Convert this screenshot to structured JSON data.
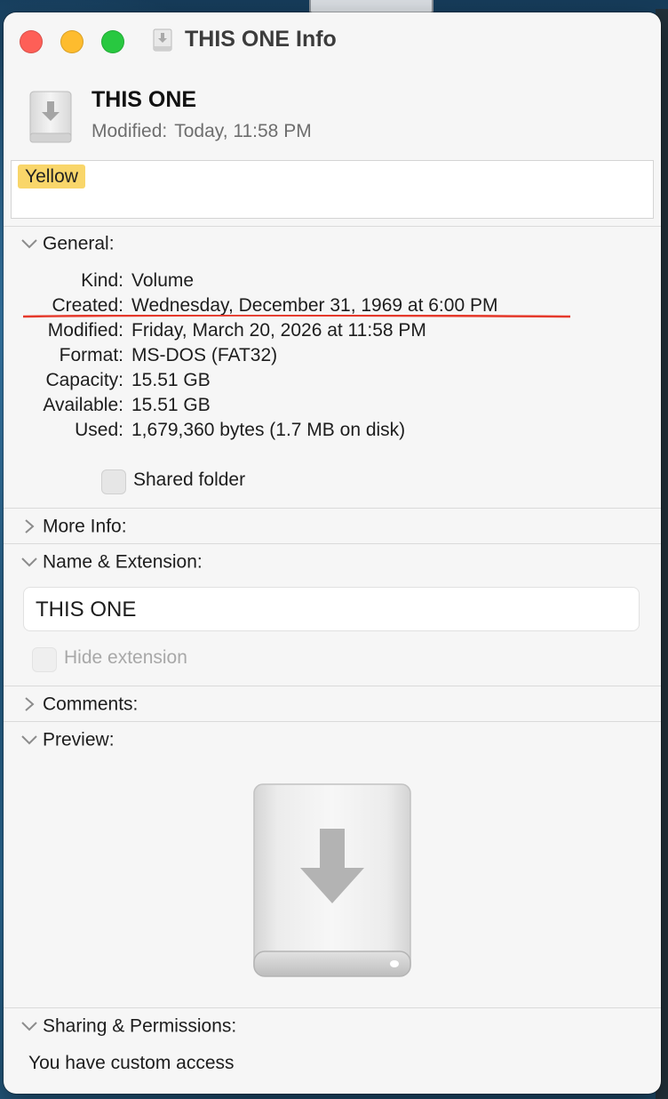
{
  "window": {
    "title": "THIS ONE Info"
  },
  "header": {
    "name": "THIS ONE",
    "modified_label": "Modified:",
    "modified_value": "Today, 11:58 PM"
  },
  "tags": [
    "Yellow"
  ],
  "colors": {
    "tag_yellow": "#f9d66a",
    "close": "#fe5f57",
    "minimize": "#febc2e",
    "zoom": "#28c840",
    "annotation_red": "#e5392b"
  },
  "general": {
    "label": "General:",
    "expanded": true,
    "rows": [
      {
        "key": "Kind:",
        "value": "Volume"
      },
      {
        "key": "Created:",
        "value": "Wednesday, December 31, 1969 at 6:00 PM"
      },
      {
        "key": "Modified:",
        "value": "Friday, March 20, 2026 at 11:58 PM"
      },
      {
        "key": "Format:",
        "value": "MS-DOS (FAT32)"
      },
      {
        "key": "Capacity:",
        "value": "15.51 GB"
      },
      {
        "key": "Available:",
        "value": "15.51 GB"
      },
      {
        "key": "Used:",
        "value": "1,679,360 bytes (1.7 MB on disk)"
      }
    ],
    "shared_folder_label": "Shared folder"
  },
  "more_info": {
    "label": "More Info:",
    "expanded": false
  },
  "name_extension": {
    "label": "Name & Extension:",
    "expanded": true,
    "name_value": "THIS ONE",
    "hide_extension_label": "Hide extension"
  },
  "comments": {
    "label": "Comments:",
    "expanded": false
  },
  "preview": {
    "label": "Preview:",
    "expanded": true,
    "icon": "external-drive-icon"
  },
  "sharing": {
    "label": "Sharing & Permissions:",
    "expanded": true,
    "status": "You have custom access"
  }
}
